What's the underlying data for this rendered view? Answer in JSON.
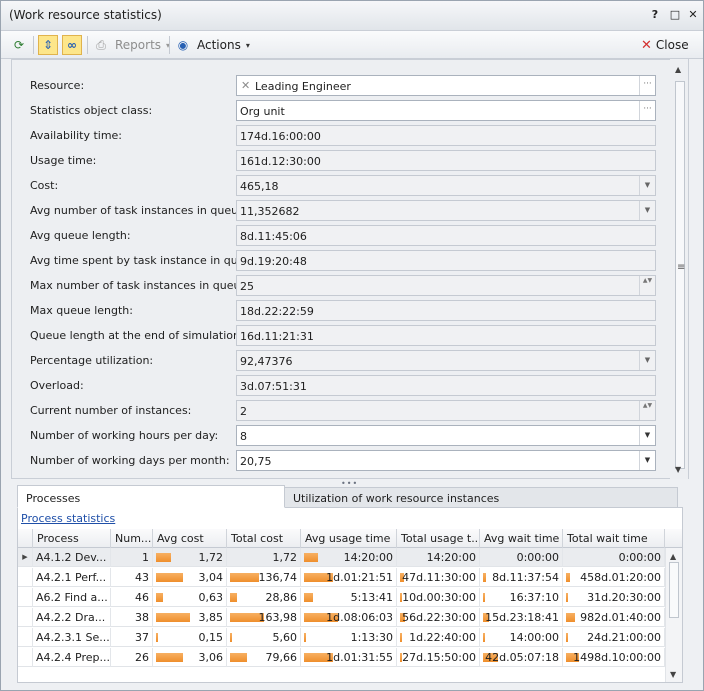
{
  "window": {
    "title": "(Work resource statistics)",
    "help_glyph": "?",
    "restore_glyph": "□",
    "close_glyph": "✕"
  },
  "toolbar": {
    "refresh_glyph": "⟳",
    "sync_glyph": "⇕",
    "link_glyph": "∞",
    "print_glyph": "⎙",
    "reports_label": "Reports",
    "actions_label": "Actions",
    "actions_glyph": "◉",
    "close_label": "Close",
    "close_glyph": "✕",
    "caret": "▾"
  },
  "form": {
    "fields": [
      {
        "label": "Resource:",
        "value": "Leading Engineer"
      },
      {
        "label": "Statistics object class:",
        "value": "Org unit"
      },
      {
        "label": "Availability time:",
        "value": "174d.16:00:00"
      },
      {
        "label": "Usage time:",
        "value": "161d.12:30:00"
      },
      {
        "label": "Cost:",
        "value": "465,18"
      },
      {
        "label": "Avg number of task instances in queue:",
        "value": "11,352682"
      },
      {
        "label": "Avg queue length:",
        "value": "8d.11:45:06"
      },
      {
        "label": "Avg time spent by task instance in queue:",
        "value": "9d.19:20:48"
      },
      {
        "label": "Max number of task instances in queue:",
        "value": "25"
      },
      {
        "label": "Max queue length:",
        "value": "18d.22:22:59"
      },
      {
        "label": "Queue length at the end of simulation:",
        "value": "16d.11:21:31"
      },
      {
        "label": "Percentage utilization:",
        "value": "92,47376"
      },
      {
        "label": "Overload:",
        "value": "3d.07:51:31"
      },
      {
        "label": "Current number of instances:",
        "value": "2"
      },
      {
        "label": "Number of working hours per day:",
        "value": "8"
      },
      {
        "label": "Number of working days per month:",
        "value": "20,75"
      }
    ],
    "clear_glyph": "✕",
    "dots_glyph": "···",
    "dropdown_glyph": "▼",
    "spin_glyph": "▲▼"
  },
  "scroll": {
    "up": "▲",
    "down": "▼",
    "grip": "≡",
    "splitter": "•••"
  },
  "tabs": [
    {
      "label": "Processes"
    },
    {
      "label": "Utilization of work resource instances"
    }
  ],
  "processes": {
    "link": "Process statistics",
    "columns": [
      "Process",
      "Num...",
      "Avg cost",
      "Total cost",
      "Avg usage time",
      "Total usage t...",
      "Avg wait time",
      "Total wait time"
    ],
    "row_marker": "▶",
    "rows": [
      {
        "process": "A4.1.2 Dev...",
        "num": "1",
        "avg_cost": "1,72",
        "total_cost": "1,72",
        "avg_usage": "14:20:00",
        "total_usage": "14:20:00",
        "avg_wait": "0:00:00",
        "total_wait": "0:00:00",
        "bars": [
          0.45,
          0.0,
          0.4,
          0.0,
          0.0,
          0.0
        ]
      },
      {
        "process": "A4.2.1 Perf...",
        "num": "43",
        "avg_cost": "3,04",
        "total_cost": "136,74",
        "avg_usage": "1d.01:21:51",
        "total_usage": "47d.11:30:00",
        "avg_wait": "8d.11:37:54",
        "total_wait": "458d.01:20:00",
        "bars": [
          0.8,
          0.85,
          0.85,
          0.12,
          0.1,
          0.12
        ]
      },
      {
        "process": "A6.2 Find a...",
        "num": "46",
        "avg_cost": "0,63",
        "total_cost": "28,86",
        "avg_usage": "5:13:41",
        "total_usage": "10d.00:30:00",
        "avg_wait": "16:37:10",
        "total_wait": "31d.20:30:00",
        "bars": [
          0.2,
          0.2,
          0.25,
          0.03,
          0.02,
          0.02
        ]
      },
      {
        "process": "A4.2.2 Dra...",
        "num": "38",
        "avg_cost": "3,85",
        "total_cost": "163,98",
        "avg_usage": "1d.08:06:03",
        "total_usage": "56d.22:30:00",
        "avg_wait": "15d.23:18:41",
        "total_wait": "982d.01:40:00",
        "bars": [
          1.0,
          1.0,
          1.0,
          0.14,
          0.18,
          0.25
        ]
      },
      {
        "process": "A4.2.3.1 Se...",
        "num": "37",
        "avg_cost": "0,15",
        "total_cost": "5,60",
        "avg_usage": "1:13:30",
        "total_usage": "1d.22:40:00",
        "avg_wait": "14:00:00",
        "total_wait": "24d.21:00:00",
        "bars": [
          0.05,
          0.04,
          0.06,
          0.01,
          0.02,
          0.01
        ]
      },
      {
        "process": "A4.2.4 Prep...",
        "num": "26",
        "avg_cost": "3,06",
        "total_cost": "79,66",
        "avg_usage": "1d.01:31:55",
        "total_usage": "27d.15:50:00",
        "avg_wait": "42d.05:07:18",
        "total_wait": "1498d.10:00:00",
        "bars": [
          0.8,
          0.5,
          0.85,
          0.07,
          0.45,
          0.38
        ]
      }
    ]
  },
  "colors": {
    "bar": "#f29a3d",
    "link": "#1f4fa8",
    "active_toggle": "#fde68a"
  }
}
